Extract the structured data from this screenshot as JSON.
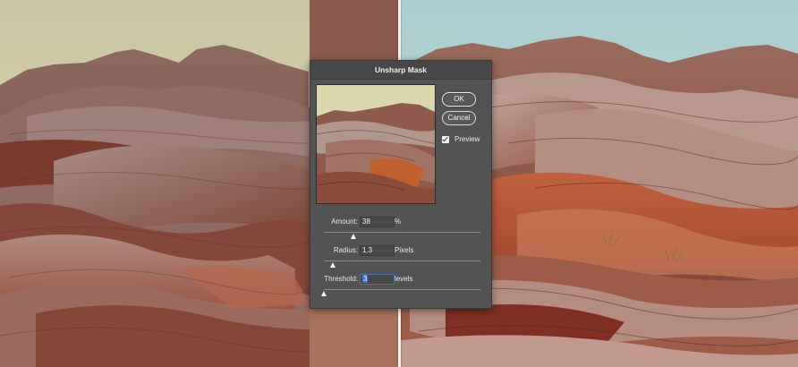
{
  "dialog": {
    "title": "Unsharp Mask",
    "ok_label": "OK",
    "cancel_label": "Cancel",
    "preview_label": "Preview",
    "preview_checked": true,
    "amount": {
      "label": "Amount:",
      "value": "38",
      "unit": "%",
      "slider_fraction": 0.2
    },
    "radius": {
      "label": "Radius:",
      "value": "1.3",
      "unit": "Pixels",
      "slider_fraction": 0.02
    },
    "threshold": {
      "label": "Threshold:",
      "value": "3",
      "unit": "levels",
      "slider_fraction": 0.01
    }
  },
  "colors": {
    "dialog_bg": "#535353",
    "titlebar_bg": "#474747",
    "sky_left": "#d8cfa8",
    "sky_right": "#b7d3d1",
    "rock_left": "#8b4a3a",
    "rock_right": "#b0593e"
  }
}
